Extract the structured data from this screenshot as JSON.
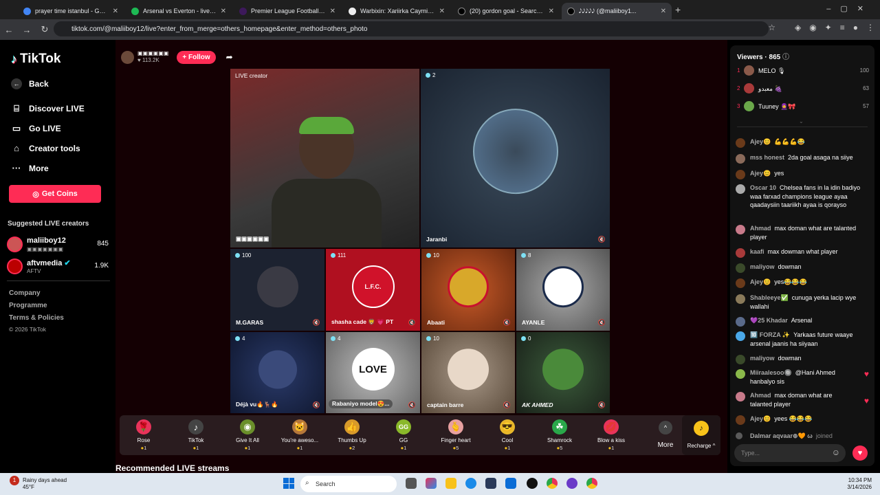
{
  "tabs": [
    {
      "title": "prayer time istanbul - Google S",
      "favicon_color": "#4285f4"
    },
    {
      "title": "Arsenal vs Everton - live score, g",
      "favicon_color": "#1db954"
    },
    {
      "title": "Premier League Football News,",
      "favicon_color": "#3d195b"
    },
    {
      "title": "Warbixin: Xariirka Caymiska ee",
      "favicon_color": "#eeeeee"
    },
    {
      "title": "(20) gordon goal - Search / X",
      "favicon_color": "#000000"
    },
    {
      "title": "𝅘𝅥𝅮𝅘𝅥𝅮𝅘𝅥𝅮𝅘𝅥𝅮𝅘𝅥𝅮 (@maliiboy1...",
      "favicon_color": "#000000"
    }
  ],
  "url": "tiktok.com/@maliiboy12/live?enter_from_merge=others_homepage&enter_method=others_photo",
  "brand": "TikTok",
  "nav": {
    "back": "Back",
    "discover": "Discover LIVE",
    "golive": "Go LIVE",
    "creator": "Creator tools",
    "more": "More",
    "coins": "Get Coins"
  },
  "suggested": {
    "title": "Suggested LIVE creators",
    "items": [
      {
        "name": "maliiboy12",
        "sub": "▣▣▣▣▣▣▣",
        "count": "845"
      },
      {
        "name": "aftvmedia",
        "sub": "AFTV",
        "count": "1.9K"
      }
    ]
  },
  "footer": {
    "company": "Company",
    "programme": "Programme",
    "terms": "Terms & Policies",
    "copyright": "© 2026 TikTok"
  },
  "host": {
    "name": "▣▣▣▣▣▣",
    "likes": "♥ 113.2K",
    "follow": "+ Follow"
  },
  "cells": [
    {
      "badge": "LIVE creator",
      "name": "▣▣▣▣▣▣",
      "bg": "#5b4a42"
    },
    {
      "badge": "2",
      "name": "Jaranbi",
      "bg": "#2b3a4d"
    },
    {
      "badge": "100",
      "name": "M.GARAS",
      "bg": "#1c2230"
    },
    {
      "badge": "111",
      "name": "shasha cade 🦁 💗 PT",
      "bg": "#b01020"
    },
    {
      "badge": "10",
      "name": "Abaati",
      "bg": "#8a3a18"
    },
    {
      "badge": "8",
      "name": "AYANLE",
      "bg": "#6b6b6b"
    },
    {
      "badge": "4",
      "name": "Déjà vu🔥🦌🔥",
      "bg": "#1a2548"
    },
    {
      "badge": "4",
      "name": "Rabaniyo model😍...",
      "bg": "#8f8f8f"
    },
    {
      "badge": "10",
      "name": "captain barre",
      "bg": "#7a6a5a"
    },
    {
      "badge": "0",
      "name": "AK AHMED",
      "bg": "#2a3a2a"
    }
  ],
  "gifts": [
    {
      "name": "Rose",
      "price": "1",
      "icon": "🌹",
      "color": "#e8335a"
    },
    {
      "name": "TikTok",
      "price": "1",
      "icon": "♪",
      "color": "#444"
    },
    {
      "name": "Give It All",
      "price": "1",
      "icon": "◉",
      "color": "#6a8f2a"
    },
    {
      "name": "You're aweso...",
      "price": "1",
      "icon": "🐱",
      "color": "#b5773a"
    },
    {
      "name": "Thumbs Up",
      "price": "2",
      "icon": "👍",
      "color": "#d89a2a"
    },
    {
      "name": "GG",
      "price": "1",
      "icon": "GG",
      "color": "#8ab82a"
    },
    {
      "name": "Finger heart",
      "price": "5",
      "icon": "🫰",
      "color": "#e8a0a0"
    },
    {
      "name": "Cool",
      "price": "1",
      "icon": "😎",
      "color": "#e8b82a"
    },
    {
      "name": "Shamrock",
      "price": "5",
      "icon": "☘",
      "color": "#2aa84a"
    },
    {
      "name": "Blow a kiss",
      "price": "1",
      "icon": "💋",
      "color": "#e8335a"
    }
  ],
  "more_label": "More",
  "recharge": "Recharge ^",
  "recommended": "Recommended LIVE streams",
  "viewers": {
    "title": "Viewers · 865",
    "list": [
      {
        "rank": "1",
        "name": "MELO 🎙",
        "score": "100",
        "color": "#8a5a4a"
      },
      {
        "rank": "2",
        "name": "معبدو 🍇",
        "score": "63",
        "color": "#a83a3a"
      },
      {
        "rank": "3",
        "name": "Tuuney 🧕🎀",
        "score": "57",
        "color": "#6aa84a"
      }
    ]
  },
  "chat": [
    {
      "user": "Ajey😊",
      "text": "💪💪💪😂",
      "color": "#6a3a1a",
      "lines": 1
    },
    {
      "user": "mss honest",
      "text": "2da goal asaga na siiye",
      "color": "#8a6a5a",
      "lines": 1
    },
    {
      "user": "Ajey😊",
      "text": "yes",
      "color": "#6a3a1a",
      "lines": 1
    },
    {
      "user": "Oscar 10",
      "text": "Chelsea fans in la idin badiyo waa farxad champions league ayaa qaadaysiin taariikh ayaa is qorayso",
      "color": "#aaaaaa",
      "lines": 4
    },
    {
      "user": "Ahmad",
      "text": "max doman what are talanted player",
      "color": "#c87a8a",
      "lines": 2
    },
    {
      "user": "kaafi",
      "text": "max dowman what player",
      "color": "#a83a3a",
      "lines": 1
    },
    {
      "user": "maliyow",
      "text": "dowman",
      "color": "#3a4a2a",
      "lines": 1
    },
    {
      "user": "Ajey😊",
      "text": "yes😂😂😂",
      "color": "#6a3a1a",
      "lines": 1
    },
    {
      "user": "Shableeye✅",
      "text": "cunuga yerka lacip wye wallahi",
      "color": "#8a7a5a",
      "lines": 2
    },
    {
      "user": "💜25 Khadar",
      "text": "Arsenal",
      "color": "#5a6a8a",
      "lines": 1
    },
    {
      "user": "🔟 FORZA ✨",
      "text": "Yarkaas future waaye arsenal jaanis ha siiyaan",
      "color": "#4aa8e8",
      "lines": 2
    },
    {
      "user": "maliyow",
      "text": "dowman",
      "color": "#3a4a2a",
      "lines": 1
    },
    {
      "user": "Miiraalesoo🔘",
      "text": "@Hani Ahmed hanbalyo sis",
      "color": "#8ab84a",
      "lines": 2
    },
    {
      "user": "Ahmad",
      "text": "max doman what are talanted player",
      "color": "#c87a8a",
      "lines": 2
    },
    {
      "user": "Ajey😊",
      "text": "yees 😂😂😂",
      "color": "#6a3a1a",
      "lines": 1
    },
    {
      "user": "Dalmar aqvaar⊕🧡 ω",
      "text": "joined",
      "color": "#5a5a5a",
      "lines": 1
    }
  ],
  "chat_placeholder": "Type...",
  "taskbar": {
    "weather_title": "Rainy days ahead",
    "weather_temp": "45°F",
    "search": "Search",
    "time": "10:34 PM",
    "date": "3/14/2026"
  }
}
